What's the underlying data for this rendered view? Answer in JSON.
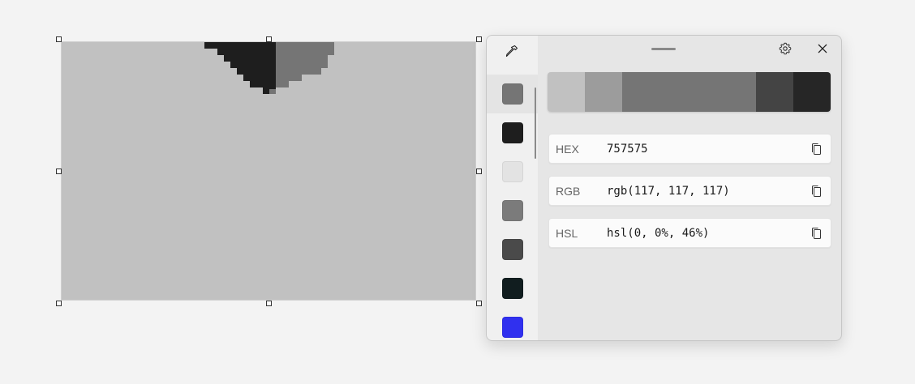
{
  "canvas": {
    "background": "#c1c1c1",
    "shape_colors": [
      "#1e1e1e",
      "#757575"
    ]
  },
  "panel": {
    "icons": {
      "picker": "eyedropper-icon",
      "settings": "gear-icon",
      "close": "close-icon",
      "copy": "copy-icon"
    },
    "history": [
      {
        "color": "#757575",
        "selected": true
      },
      {
        "color": "#1e1e1e",
        "selected": false
      },
      {
        "color": "#e3e3e3",
        "selected": false
      },
      {
        "color": "#7b7b7b",
        "selected": false
      },
      {
        "color": "#4a4a4a",
        "selected": false
      },
      {
        "color": "#111d1f",
        "selected": false
      },
      {
        "color": "#3030ef",
        "selected": false
      }
    ],
    "gradient": [
      "#c1c1c1",
      "#9c9c9c",
      "#757575",
      "#757575",
      "#757575",
      "#444444",
      "#262626"
    ],
    "formats": [
      {
        "label": "HEX",
        "value": "757575"
      },
      {
        "label": "RGB",
        "value": "rgb(117, 117, 117)"
      },
      {
        "label": "HSL",
        "value": "hsl(0, 0%, 46%)"
      }
    ]
  }
}
